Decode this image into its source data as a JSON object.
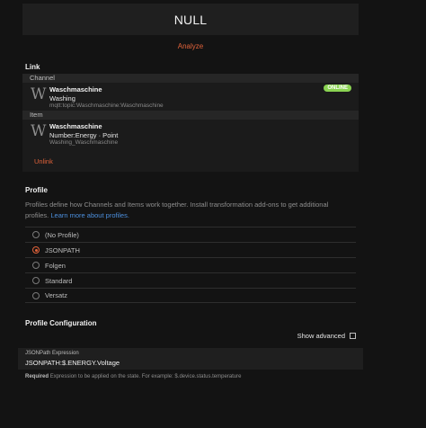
{
  "state": {
    "value": "NULL"
  },
  "analyze_label": "Analyze",
  "link": {
    "title": "Link",
    "channel_header": "Channel",
    "channel": {
      "icon_letter": "W",
      "name": "Waschmaschine",
      "label": "Washing",
      "uid": "mqtt:topic:Waschmaschine:Waschmaschine",
      "status": "ONLINE"
    },
    "item_header": "Item",
    "item": {
      "icon_letter": "W",
      "name": "Waschmaschine",
      "type": "Number:Energy · Point",
      "id": "Washing_Waschmaschine"
    },
    "unlink_label": "Unlink"
  },
  "profile": {
    "title": "Profile",
    "description": "Profiles define how Channels and Items work together. Install transformation add-ons to get additional profiles.",
    "learn_more": "Learn more about profiles.",
    "options": [
      {
        "label": "(No Profile)",
        "selected": false
      },
      {
        "label": "JSONPATH",
        "selected": true
      },
      {
        "label": "Folgen",
        "selected": false
      },
      {
        "label": "Standard",
        "selected": false
      },
      {
        "label": "Versatz",
        "selected": false
      }
    ]
  },
  "profile_config": {
    "title": "Profile Configuration",
    "show_advanced": "Show advanced",
    "field_label": "JSONPath Expression",
    "field_value": "JSONPATH:$.ENERGY.Voltage",
    "required": "Required",
    "hint": "Expression to be applied on the state. For example: $.device.status.temperature"
  },
  "colors": {
    "accent": "#e0623a",
    "online": "#8ad352",
    "link": "#4c8fdd",
    "background": "#131313"
  }
}
